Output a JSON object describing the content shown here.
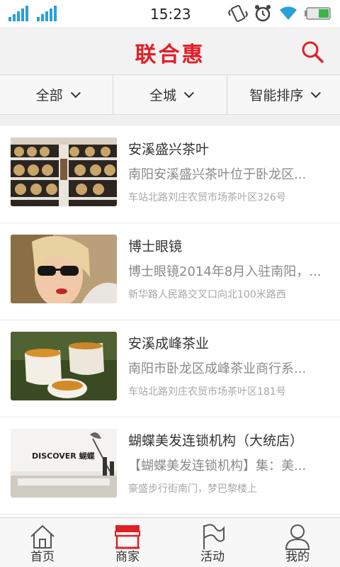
{
  "status_bar": {
    "time": "15:23"
  },
  "header": {
    "title": "联合惠"
  },
  "filters": [
    {
      "label": "全部"
    },
    {
      "label": "全城"
    },
    {
      "label": "智能排序"
    }
  ],
  "shops": [
    {
      "name": "安溪盛兴茶叶",
      "desc": "南阳安溪盛兴茶叶位于卧龙区...",
      "address": "车站北路刘庄农贸市场茶叶区326号"
    },
    {
      "name": "博士眼镜",
      "desc": "博士眼镜2014年8月入驻南阳，...",
      "address": "新华路人民路交叉口向北100米路西"
    },
    {
      "name": "安溪成峰茶业",
      "desc": "南阳市卧龙区成峰茶业商行系...",
      "address": "车站北路刘庄农贸市场茶叶区181号"
    },
    {
      "name": "蝴蝶美发连锁机构（大统店）",
      "desc": "【蝴蝶美发连锁机构】集：美...",
      "address": "豪盛步行街南门，梦巴黎楼上",
      "photo_text": "DISCOVER 蝴蝶"
    }
  ],
  "tabs": [
    {
      "label": "首页",
      "icon": "home-icon"
    },
    {
      "label": "商家",
      "icon": "shop-icon",
      "active": true
    },
    {
      "label": "活动",
      "icon": "flag-icon"
    },
    {
      "label": "我的",
      "icon": "user-icon"
    }
  ],
  "colors": {
    "brand": "#e21e26",
    "signal": "#2aa0d8"
  }
}
